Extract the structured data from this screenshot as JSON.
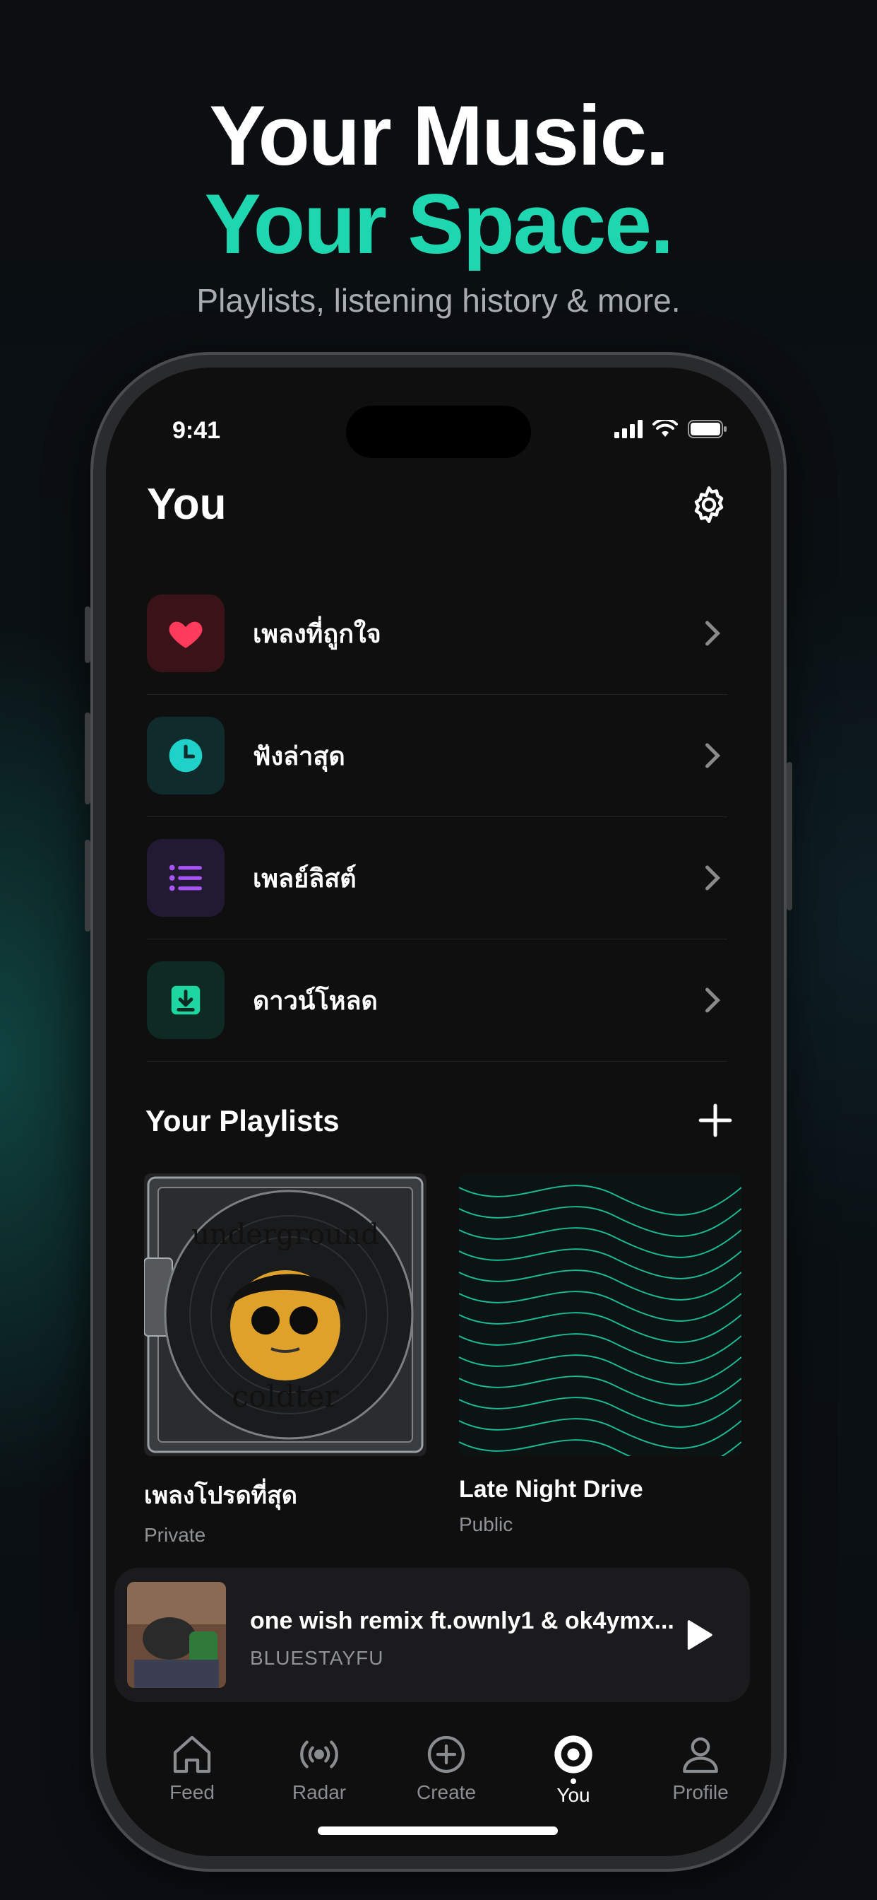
{
  "hero": {
    "line1": "Your Music.",
    "line2": "Your Space.",
    "subtitle": "Playlists, listening history & more."
  },
  "status_bar": {
    "time": "9:41"
  },
  "page": {
    "title": "You"
  },
  "menu": {
    "items": [
      {
        "label": "เพลงที่ถูกใจ",
        "icon": "heart-icon",
        "color": "#ff3b5c"
      },
      {
        "label": "ฟังล่าสุด",
        "icon": "clock-icon",
        "color": "#1fd1c8"
      },
      {
        "label": "เพลย์ลิสต์",
        "icon": "list-icon",
        "color": "#a855f7"
      },
      {
        "label": "ดาวน์โหลด",
        "icon": "download-icon",
        "color": "#1ed6a0"
      }
    ]
  },
  "playlists": {
    "title": "Your Playlists",
    "items": [
      {
        "title": "เพลงโปรดที่สุด",
        "visibility": "Private",
        "art_text_top": "underground",
        "art_text_bottom": "coldter"
      },
      {
        "title": "Late Night Drive",
        "visibility": "Public"
      }
    ]
  },
  "now_playing": {
    "title": "one wish remix ft.ownly1 & ok4ymx...",
    "artist": "BLUESTAYFU"
  },
  "tabs": [
    {
      "label": "Feed",
      "icon": "home-icon"
    },
    {
      "label": "Radar",
      "icon": "radar-icon"
    },
    {
      "label": "Create",
      "icon": "plus-circle-icon"
    },
    {
      "label": "You",
      "icon": "target-icon",
      "active": true
    },
    {
      "label": "Profile",
      "icon": "person-icon"
    }
  ],
  "colors": {
    "accent": "#1ed6b0",
    "background": "#0f0f10"
  }
}
